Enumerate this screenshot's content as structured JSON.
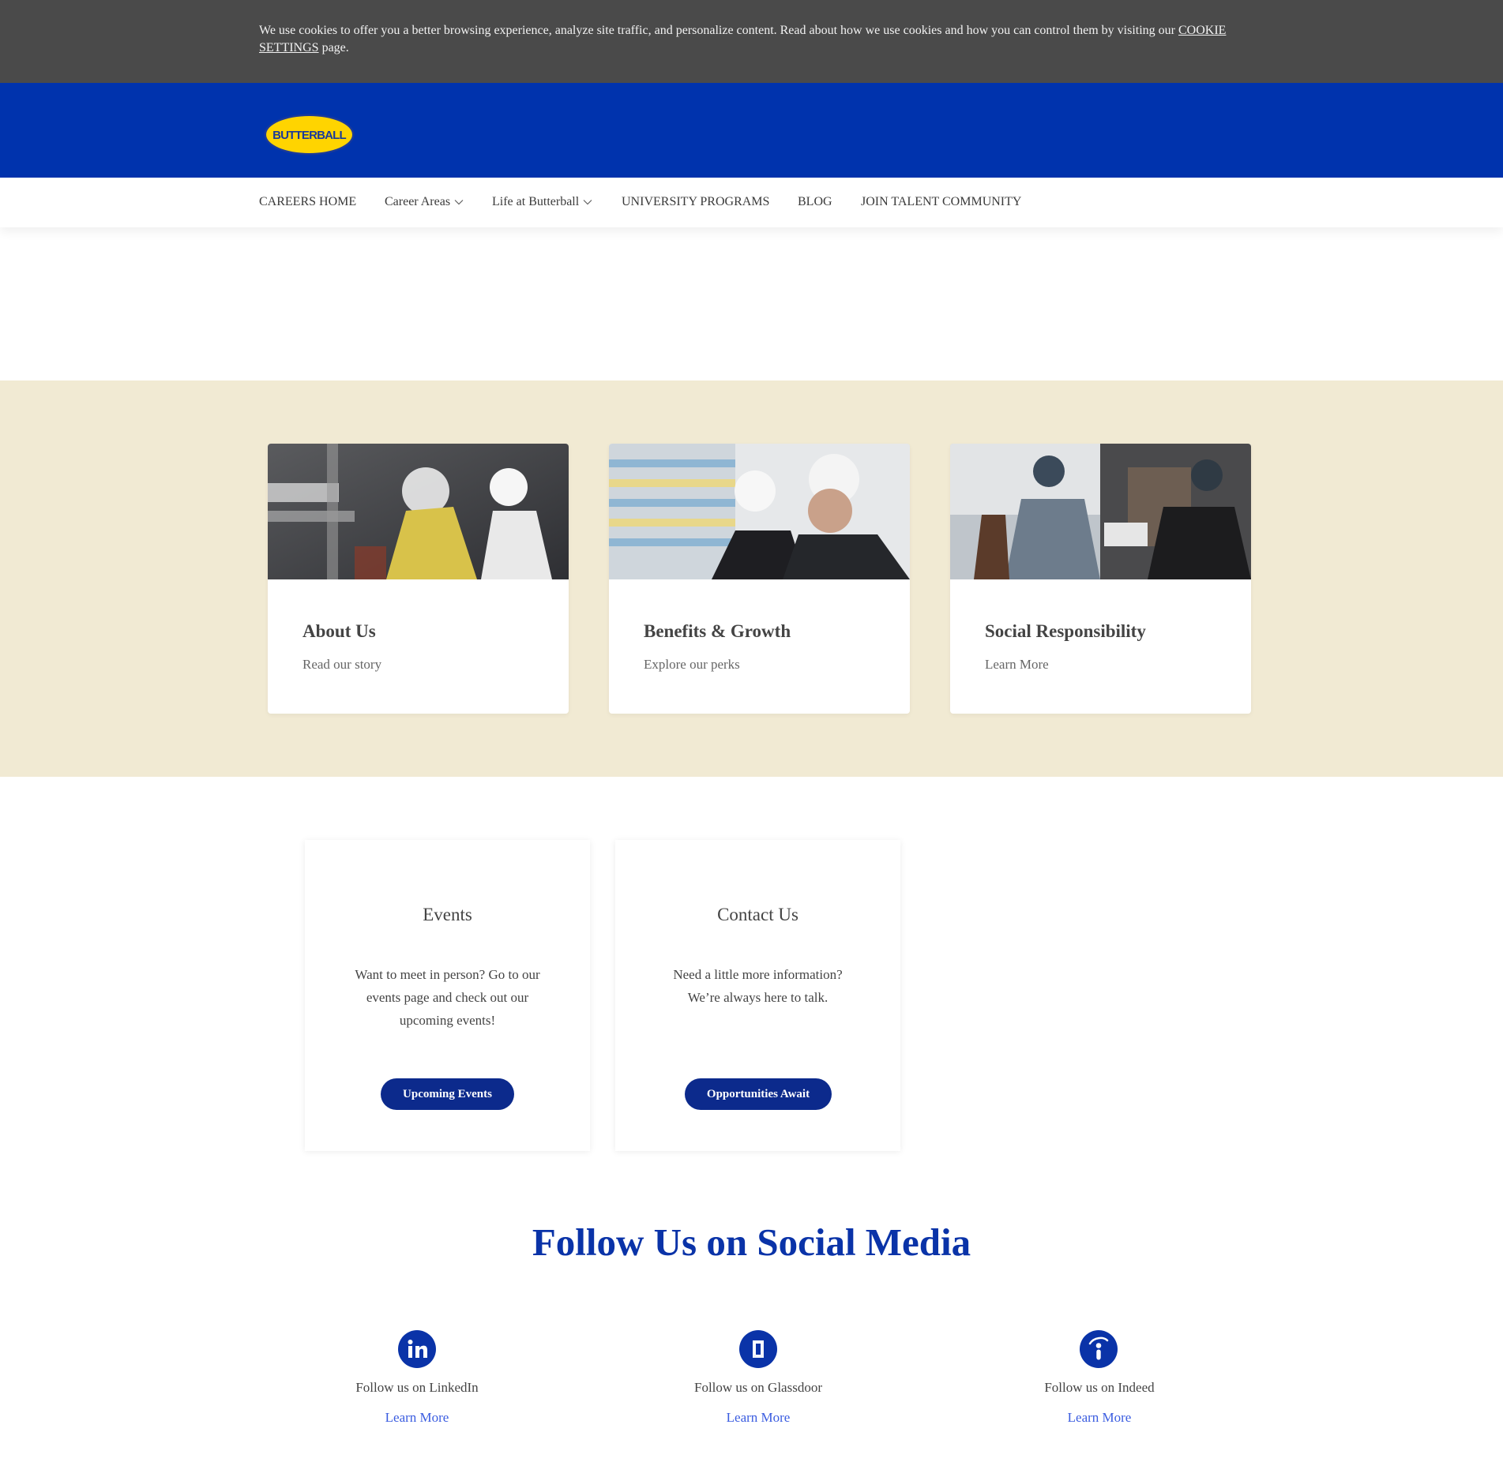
{
  "cookie_banner": {
    "text": "We use cookies to offer you a better browsing experience, analyze site traffic, and personalize content. Read about how we use cookies and how you can control them by visiting our ",
    "link_label": "COOKIE SETTINGS",
    "suffix": " page."
  },
  "header": {
    "logo_alt": "BUTTERBALL",
    "brand_color": "#0033ad",
    "logo_color": "#ffd400"
  },
  "nav": {
    "items": [
      {
        "label": "CAREERS HOME",
        "has_dropdown": false
      },
      {
        "label": "Career Areas",
        "has_dropdown": true
      },
      {
        "label": "Life at Butterball",
        "has_dropdown": true
      },
      {
        "label": "UNIVERSITY PROGRAMS",
        "has_dropdown": false
      },
      {
        "label": "BLOG",
        "has_dropdown": false
      },
      {
        "label": "JOIN TALENT COMMUNITY",
        "has_dropdown": false
      }
    ],
    "dropdown_icon": "chevron-down-icon"
  },
  "feature_cards": [
    {
      "title": "About Us",
      "subtitle": "Read our story"
    },
    {
      "title": "Benefits & Growth",
      "subtitle": "Explore our perks"
    },
    {
      "title": "Social Responsibility",
      "subtitle": "Learn More"
    }
  ],
  "info_boxes": [
    {
      "title": "Events",
      "lines": [
        "Want to meet in person? Go to our",
        "events page and check out our",
        "upcoming events!"
      ],
      "button": "Upcoming Events"
    },
    {
      "title": "Contact Us",
      "lines": [
        "Need a little more information?",
        "We’re always here to talk."
      ],
      "button": "Opportunities Await"
    }
  ],
  "social": {
    "heading": "Follow Us on Social Media",
    "items": [
      {
        "icon": "linkedin-icon",
        "label": "Follow us on LinkedIn",
        "link": "Learn More"
      },
      {
        "icon": "glassdoor-icon",
        "label": "Follow us on Glassdoor",
        "link": "Learn More"
      },
      {
        "icon": "indeed-icon",
        "label": "Follow us on Indeed",
        "link": "Learn More"
      }
    ]
  },
  "colors": {
    "cookie_bg": "#4a4a4a",
    "band_bg": "#f1ead3",
    "button_bg": "#0c2a8c",
    "heading_blue": "#0a33a8",
    "link_blue": "#3a5ce0"
  }
}
